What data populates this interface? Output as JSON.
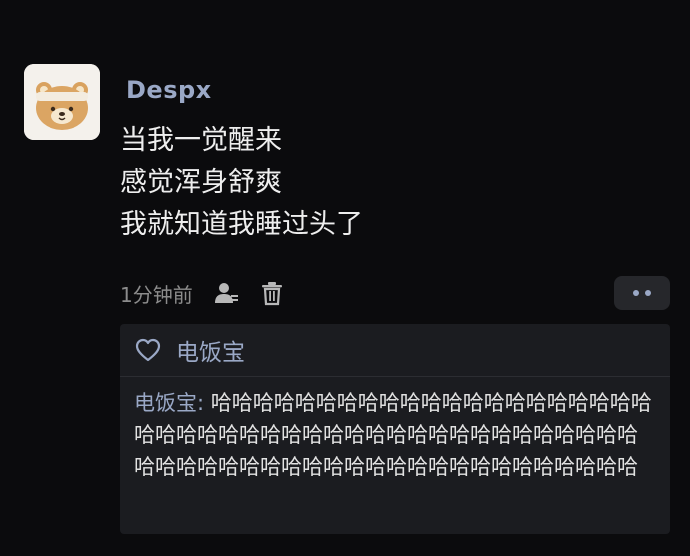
{
  "post": {
    "username": "Despx",
    "lines": [
      "当我一觉醒来",
      "感觉浑身舒爽",
      "我就知道我睡过头了"
    ],
    "timestamp": "1分钟前",
    "icons": {
      "avatar": "avatar",
      "user": "user-icon",
      "delete": "trash-icon",
      "more": "more-dots-icon"
    }
  },
  "likes": {
    "icon": "heart-icon",
    "names": "电饭宝"
  },
  "comment": {
    "author": "电饭宝",
    "separator": ": ",
    "text": "哈哈哈哈哈哈哈哈哈哈哈哈哈哈哈哈哈哈哈哈哈哈哈哈哈哈哈哈哈哈哈哈哈哈哈哈哈哈哈哈哈哈哈哈哈哈哈哈哈哈哈哈哈哈哈哈哈哈哈哈哈哈哈哈哈哈哈哈哈"
  },
  "colors": {
    "background": "#0b0b0d",
    "username": "#9aa8c6",
    "reply_box": "#1b1c20"
  }
}
